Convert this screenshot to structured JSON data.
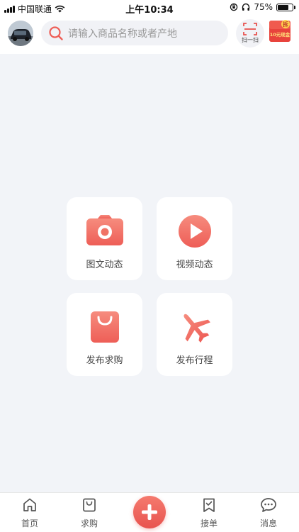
{
  "status_bar": {
    "carrier": "中国联通",
    "time": "上午10:34",
    "battery": "75%",
    "battery_level": 0.75
  },
  "header": {
    "search_placeholder": "请输入商品名称或者产地",
    "scan_label": "扫一扫",
    "promo_badge": "拆",
    "promo_text": "10元现金"
  },
  "tiles": [
    {
      "label": "图文动态",
      "icon": "camera-icon"
    },
    {
      "label": "视频动态",
      "icon": "play-icon"
    },
    {
      "label": "发布求购",
      "icon": "shopping-bag-icon"
    },
    {
      "label": "发布行程",
      "icon": "airplane-icon"
    }
  ],
  "tabbar": {
    "items": [
      {
        "label": "首页",
        "icon": "home-icon"
      },
      {
        "label": "求购",
        "icon": "bag-icon"
      },
      {
        "label": "接单",
        "icon": "bookmark-check-icon"
      },
      {
        "label": "消息",
        "icon": "chat-icon"
      }
    ],
    "center_icon": "plus-icon"
  },
  "colors": {
    "accent": "#ee5e57",
    "accent_light": "#f68c7e",
    "background": "#f2f4f8"
  }
}
